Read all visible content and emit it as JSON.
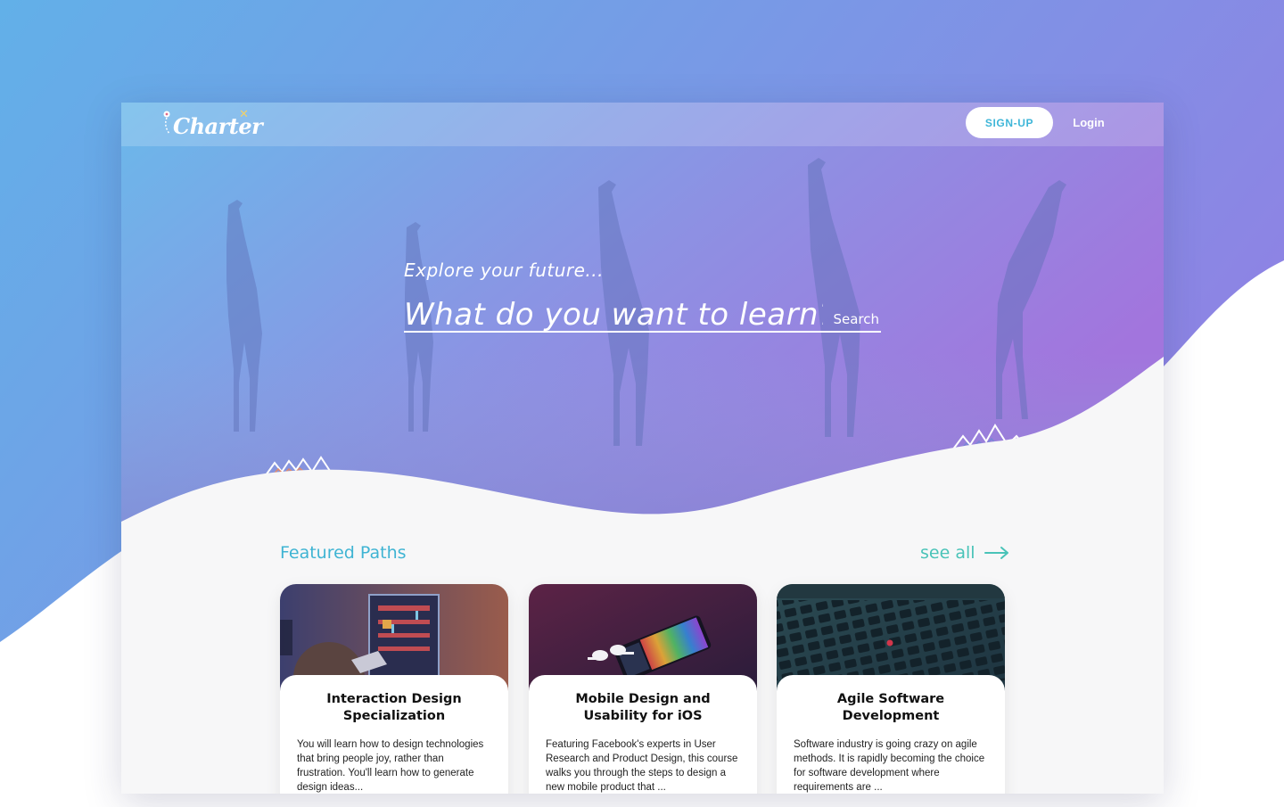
{
  "colors": {
    "backdrop_start": "#63b0e8",
    "backdrop_end": "#8f83e3",
    "accent_blue": "#3fb4d3",
    "accent_teal": "#49c3b8",
    "hero_start": "#6bb7ea",
    "hero_end": "#9d7de0"
  },
  "navbar": {
    "logo_text": "Charter",
    "logo_icon": "map-pin-icon",
    "signup_label": "SIGN-UP",
    "login_label": "Login"
  },
  "hero": {
    "tagline": "Explore your future...",
    "search_placeholder": "What do you want to learn?",
    "search_button_label": "Search",
    "background_image": "giraffes-savanna"
  },
  "featured": {
    "title": "Featured Paths",
    "see_all_label": "see all",
    "see_all_icon": "arrow-right-icon",
    "cards": [
      {
        "title": "Interaction Design Specialization",
        "description": "You will learn how to design technologies that bring people joy, rather than frustration. You'll learn how to generate design ideas...",
        "image": "arcade-game-child"
      },
      {
        "title": "Mobile Design and Usability for iOS",
        "description": "Featuring Facebook's experts in User Research and Product Design, this course walks you through the steps to design a new mobile product that ...",
        "image": "phone-and-earbuds"
      },
      {
        "title": "Agile Software Development",
        "description": "Software industry is going crazy on agile methods.  It is rapidly becoming the choice for software development where requirements are ...",
        "image": "laptop-keyboard"
      }
    ]
  }
}
